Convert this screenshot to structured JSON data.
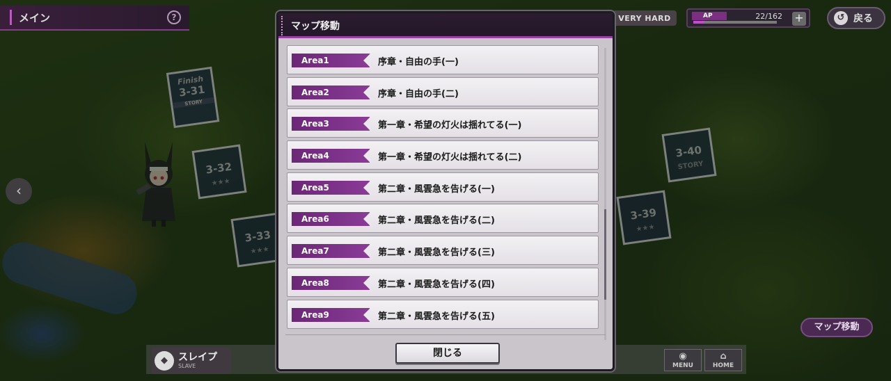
{
  "header": {
    "title": "メイン",
    "help_icon": "?",
    "difficulty": "VERY HARD",
    "ap_label": "AP",
    "ap_value": "22/162",
    "ap_fraction": 0.136,
    "ap_plus": "+",
    "back_label": "戻る"
  },
  "map": {
    "nodes": [
      {
        "id": "3-31",
        "finish": "Finish",
        "story": "STORY"
      },
      {
        "id": "3-32",
        "stars": "★★★"
      },
      {
        "id": "3-33",
        "stars": "★★★"
      },
      {
        "id": "3-39",
        "stars": "★★★"
      },
      {
        "id": "3-40",
        "story": "STORY"
      }
    ],
    "map_move_label": "マップ移動"
  },
  "bottom": {
    "slave_label": "スレイプ",
    "slave_sub": "SLAVE",
    "menu_label": "MENU",
    "home_label": "HOME"
  },
  "modal": {
    "title": "マップ移動",
    "areas": [
      {
        "tag": "Area1",
        "name": "序章・自由の手(一)"
      },
      {
        "tag": "Area2",
        "name": "序章・自由の手(二)"
      },
      {
        "tag": "Area3",
        "name": "第一章・希望の灯火は揺れてる(一)"
      },
      {
        "tag": "Area4",
        "name": "第一章・希望の灯火は揺れてる(二)"
      },
      {
        "tag": "Area5",
        "name": "第二章・風雲急を告げる(一)"
      },
      {
        "tag": "Area6",
        "name": "第二章・風雲急を告げる(二)"
      },
      {
        "tag": "Area7",
        "name": "第二章・風雲急を告げる(三)"
      },
      {
        "tag": "Area8",
        "name": "第二章・風雲急を告げる(四)"
      },
      {
        "tag": "Area9",
        "name": "第二章・風雲急を告げる(五)"
      }
    ],
    "scroll_fraction": 0.8,
    "close_label": "閉じる"
  },
  "colors": {
    "accent": "#8a3b97",
    "header_bg": "#2b1c2e",
    "modal_bg": "#c9c5cb"
  }
}
